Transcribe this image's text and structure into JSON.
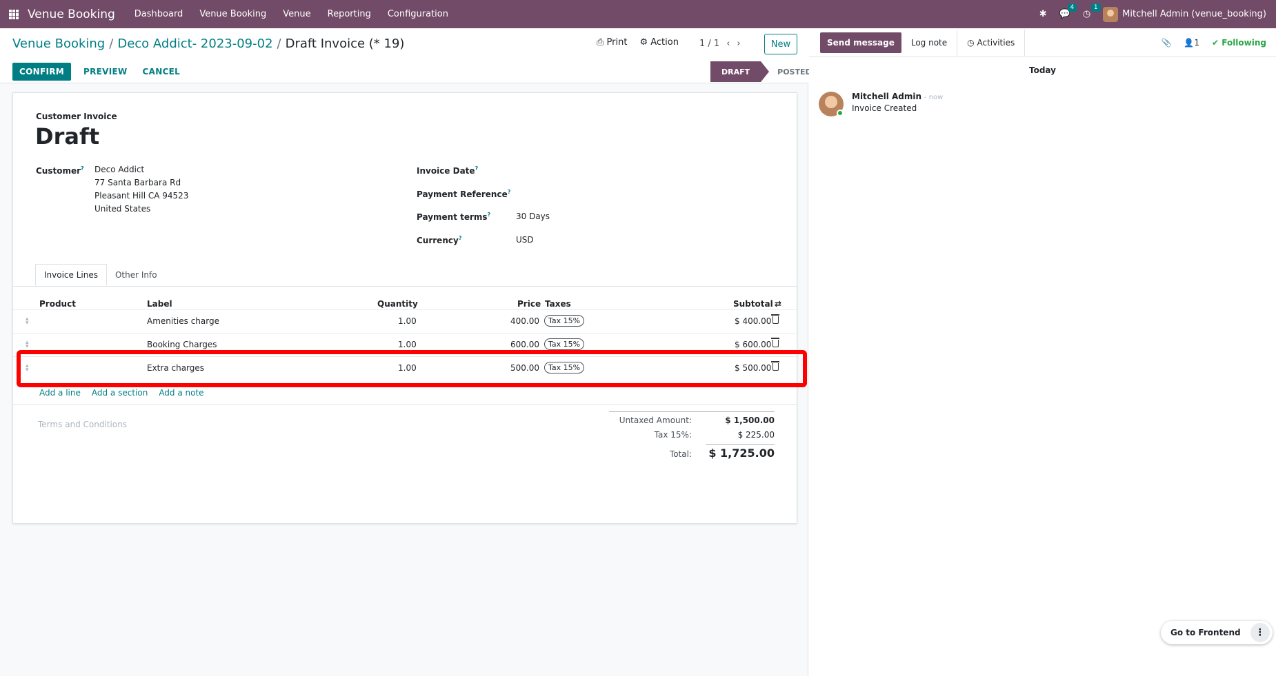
{
  "topbar": {
    "brand": "Venue Booking",
    "menu": [
      "Dashboard",
      "Venue Booking",
      "Venue",
      "Reporting",
      "Configuration"
    ],
    "chat_count": "4",
    "activity_count": "1",
    "user": "Mitchell Admin (venue_booking)"
  },
  "control_panel": {
    "breadcrumb": [
      "Venue Booking",
      "Deco Addict- 2023-09-02"
    ],
    "current": "Draft Invoice (* 19)",
    "print_label": "Print",
    "action_label": "Action",
    "pager": "1 / 1",
    "new_label": "New",
    "confirm_label": "CONFIRM",
    "preview_label": "PREVIEW",
    "cancel_label": "CANCEL",
    "status_draft": "DRAFT",
    "status_posted": "POSTED"
  },
  "invoice": {
    "doc_type": "Customer Invoice",
    "name": "Draft",
    "customer_label": "Customer",
    "customer_lines": [
      "Deco Addict",
      "77 Santa Barbara Rd",
      "Pleasant Hill CA 94523",
      "United States"
    ],
    "invoice_date_label": "Invoice Date",
    "payment_ref_label": "Payment Reference",
    "payment_terms_label": "Payment terms",
    "payment_terms": "30 Days",
    "currency_label": "Currency",
    "currency": "USD",
    "tabs": [
      "Invoice Lines",
      "Other Info"
    ],
    "columns": {
      "product": "Product",
      "label": "Label",
      "quantity": "Quantity",
      "price": "Price",
      "taxes": "Taxes",
      "subtotal": "Subtotal"
    },
    "lines": [
      {
        "label": "Amenities charge",
        "quantity": "1.00",
        "price": "400.00",
        "tax": "Tax 15%",
        "subtotal": "$ 400.00"
      },
      {
        "label": "Booking Charges",
        "quantity": "1.00",
        "price": "600.00",
        "tax": "Tax 15%",
        "subtotal": "$ 600.00"
      },
      {
        "label": "Extra charges",
        "quantity": "1.00",
        "price": "500.00",
        "tax": "Tax 15%",
        "subtotal": "$ 500.00"
      }
    ],
    "add_line": "Add a line",
    "add_section": "Add a section",
    "add_note": "Add a note",
    "terms_placeholder": "Terms and Conditions",
    "untaxed_label": "Untaxed Amount:",
    "untaxed_value": "$ 1,500.00",
    "tax_label": "Tax 15%:",
    "tax_value": "$ 225.00",
    "total_label": "Total:",
    "total_value": "$ 1,725.00"
  },
  "chatter": {
    "send_message": "Send message",
    "log_note": "Log note",
    "activities": "Activities",
    "follower_count": "1",
    "following": "Following",
    "today": "Today",
    "author": "Mitchell Admin",
    "date": "- now",
    "body": "Invoice Created"
  },
  "go_to_frontend": "Go to Frontend"
}
